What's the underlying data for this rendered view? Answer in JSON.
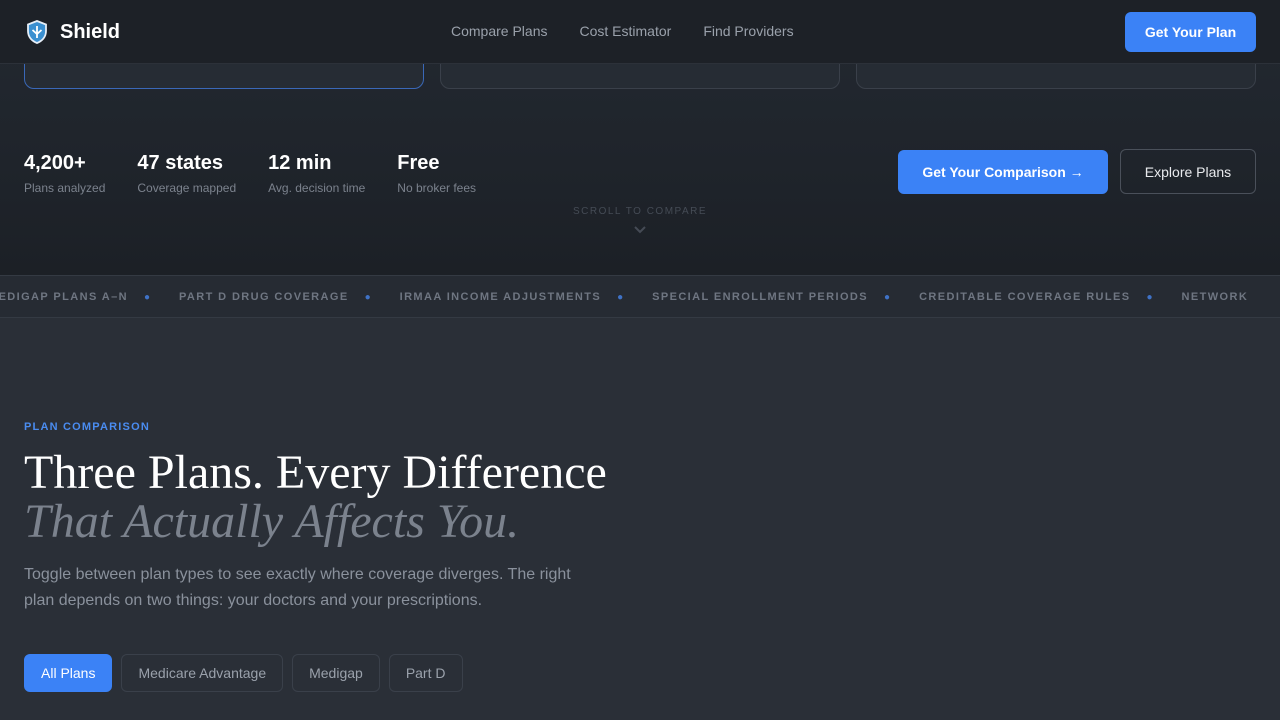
{
  "nav": {
    "brand": "Shield",
    "links": [
      "Compare Plans",
      "Cost Estimator",
      "Find Providers"
    ],
    "cta": "Get Your Plan"
  },
  "hero": {
    "stats": [
      {
        "value": "4,200+",
        "label": "Plans analyzed"
      },
      {
        "value": "47 states",
        "label": "Coverage mapped"
      },
      {
        "value": "12 min",
        "label": "Avg. decision time"
      },
      {
        "value": "Free",
        "label": "No broker fees"
      }
    ],
    "primary_cta": "Get Your Comparison →",
    "secondary_cta": "Explore Plans",
    "scroll_hint": "SCROLL TO COMPARE"
  },
  "ticker": {
    "items": [
      "MEDIGAP PLANS A–N",
      "PART D DRUG COVERAGE",
      "IRMAA INCOME ADJUSTMENTS",
      "SPECIAL ENROLLMENT PERIODS",
      "CREDITABLE COVERAGE RULES",
      "NETWORK"
    ]
  },
  "section": {
    "eyebrow": "PLAN COMPARISON",
    "headline": "Three Plans. Every Difference",
    "headline_italic": "That Actually Affects You.",
    "description": "Toggle between plan types to see exactly where coverage diverges. The right plan depends on two things: your doctors and your prescriptions.",
    "filters": [
      "All Plans",
      "Medicare Advantage",
      "Medigap",
      "Part D"
    ],
    "active_filter": "All Plans"
  },
  "colors": {
    "accent": "#3b82f6",
    "background": "#2a2f37",
    "nav_background": "#1d2127"
  },
  "icons": {
    "brand": "shield-icon",
    "scroll": "chevron-down-icon"
  }
}
